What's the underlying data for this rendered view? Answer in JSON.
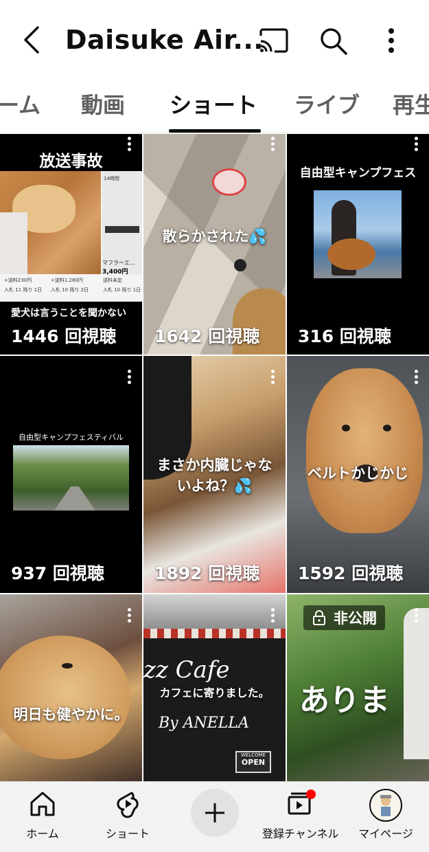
{
  "header": {
    "title": "Daisuke Air...",
    "back_icon": "back-arrow-icon",
    "cast_icon": "cast-icon",
    "search_icon": "search-icon",
    "more_icon": "more-vert-icon"
  },
  "tabs": [
    {
      "label": "ーム",
      "active": false
    },
    {
      "label": "動画",
      "active": false
    },
    {
      "label": "ショート",
      "active": true
    },
    {
      "label": "ライブ",
      "active": false
    },
    {
      "label": "再生",
      "active": false
    }
  ],
  "shorts": [
    {
      "title_top": "放送事故",
      "caption": "愛犬は言うことを聞かない",
      "views": "1446 回視聴",
      "listing": {
        "prices": [
          "+送料230円",
          "+送料1,280円",
          "送料未定"
        ],
        "bids": [
          "入札 11 残り 1日",
          "入札 10 残り 2日",
          "入札 10 残り 1日"
        ],
        "item_price": "3,400円",
        "item_name": "マフラーエ…",
        "time": "14時間"
      }
    },
    {
      "caption": "散らかされた💦",
      "views": "1642 回視聴"
    },
    {
      "title_top": "自由型キャンプフェス",
      "views": "316 回視聴"
    },
    {
      "title_top": "自由型キャンプフェスティバル",
      "views": "937 回視聴"
    },
    {
      "caption": "まさか内臓じゃないよね？💦",
      "views": "1892 回視聴"
    },
    {
      "caption": "ベルトかじかじ",
      "views": "1592 回視聴"
    },
    {
      "caption": "明日も健やかに。",
      "views": ""
    },
    {
      "caption": "カフェに寄りました。",
      "views": "",
      "sign_cafe": "zz Cafe",
      "sign_by": "By ANELLA",
      "sign_welcome": "WELCOME",
      "sign_open": "OPEN"
    },
    {
      "caption": "ありま",
      "views": "",
      "private_label": "非公開"
    }
  ],
  "bottom_nav": {
    "home": "ホーム",
    "shorts": "ショート",
    "subscriptions": "登録チャンネル",
    "mypage": "マイページ"
  },
  "colors": {
    "accent_red": "#ff0000",
    "text_primary": "#0f0f0f",
    "text_secondary": "#606060"
  }
}
